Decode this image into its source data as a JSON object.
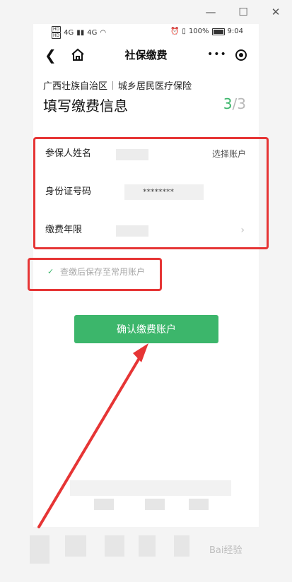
{
  "statusbar": {
    "network_left": "HD",
    "signal": "4G",
    "battery_text": "100%",
    "time": "9:04"
  },
  "nav": {
    "title": "社保缴费"
  },
  "breadcrumb": {
    "region": "广西壮族自治区",
    "insurance": "城乡居民医疗保险"
  },
  "page": {
    "title": "填写缴费信息",
    "step_current": "3",
    "step_sep": "/",
    "step_total": "3"
  },
  "form": {
    "name_label": "参保人姓名",
    "name_action": "选择账户",
    "id_label": "身份证号码",
    "id_masked": "********",
    "years_label": "缴费年限"
  },
  "save_checkbox": {
    "label": "查缴后保存至常用账户",
    "checked": true
  },
  "confirm_button": {
    "label": "确认缴费账户"
  },
  "watermark": {
    "text": "Bai经验"
  },
  "colors": {
    "accent": "#3cb66b",
    "annotation": "#e63535"
  }
}
